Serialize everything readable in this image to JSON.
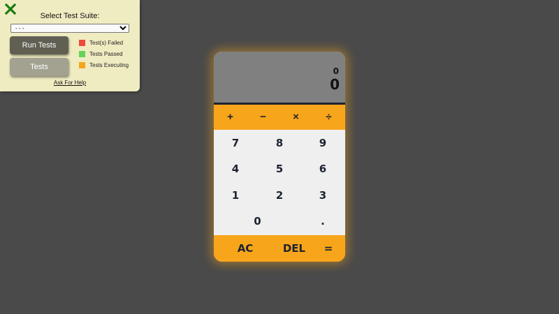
{
  "test_panel": {
    "title": "Select Test Suite:",
    "select_value": "- - -",
    "run_button": "Run Tests",
    "tests_button": "Tests",
    "help_link": "Ask For Help",
    "legend": [
      {
        "label": "Test(s) Failed",
        "color": "#ee4b3b"
      },
      {
        "label": "Tests Passed",
        "color": "#63d35a"
      },
      {
        "label": "Tests Executing",
        "color": "#f7a51a"
      }
    ],
    "close_icon": "close-x-icon",
    "close_color": "#1a7a10"
  },
  "calculator": {
    "previous_operand": "0",
    "current_operand": "0",
    "operators": [
      "+",
      "−",
      "×",
      "÷"
    ],
    "digits": {
      "seven": "7",
      "eight": "8",
      "nine": "9",
      "four": "4",
      "five": "5",
      "six": "6",
      "one": "1",
      "two": "2",
      "three": "3",
      "zero": "0",
      "decimal": "."
    },
    "clear": "AC",
    "delete": "DEL",
    "equals": "=",
    "accent_color": "#f7a51a",
    "display_color": "#808080"
  }
}
